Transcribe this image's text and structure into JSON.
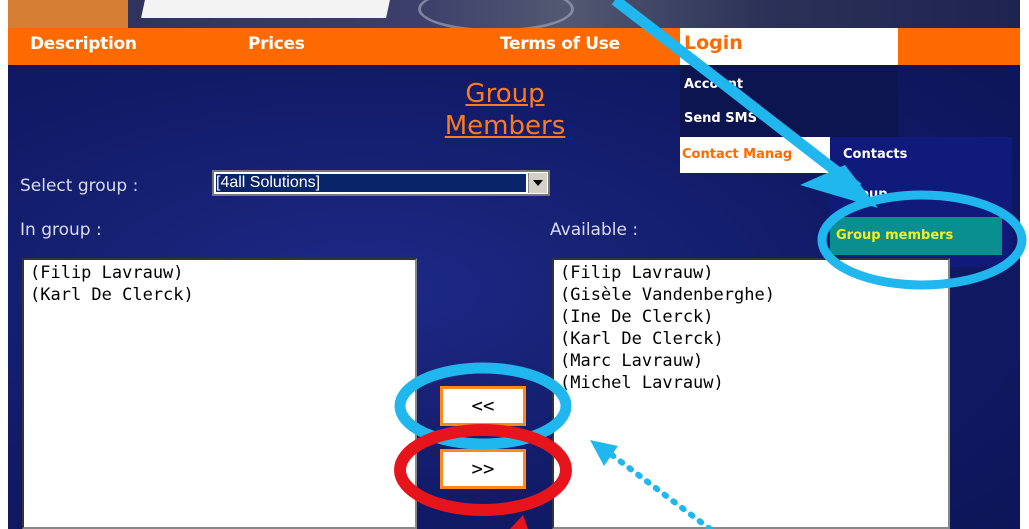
{
  "nav": {
    "description": "Description",
    "prices": "Prices",
    "terms": "Terms of Use",
    "login": "Login"
  },
  "login_menu": {
    "account": "Account",
    "send_sms": "Send SMS",
    "contact_manag": "Contact Manag"
  },
  "contact_submenu": {
    "contacts": "Contacts",
    "group": "Group",
    "group_members": "Group members"
  },
  "page": {
    "title_line1": "Group",
    "title_line2": "Members",
    "select_group_label": "Select group :",
    "selected_group": "[4all Solutions]",
    "in_group_label": "In group :",
    "available_label": "Available :"
  },
  "in_group_list": [
    "(Filip Lavrauw)",
    "(Karl De Clerck)"
  ],
  "available_list": [
    "(Filip Lavrauw)",
    "(Gisèle Vandenberghe)",
    "(Ine De Clerck)",
    "(Karl De Clerck)",
    "(Marc Lavrauw)",
    "(Michel Lavrauw)"
  ],
  "buttons": {
    "add": "<<",
    "remove": ">>"
  },
  "colors": {
    "nav_orange": "#ff6a00",
    "page_blue": "#111a66",
    "annotation_cyan": "#1fb7ee",
    "annotation_red": "#e8141b",
    "highlight_yellow": "#f6ee20"
  }
}
